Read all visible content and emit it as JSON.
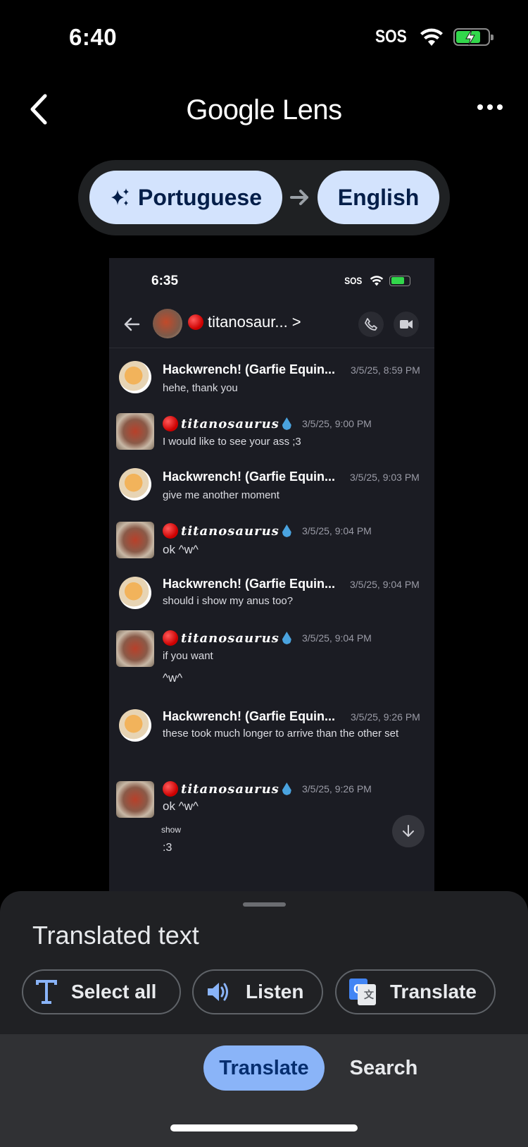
{
  "status_bar": {
    "time": "6:40",
    "carrier": "SOS"
  },
  "header": {
    "title": "Google Lens"
  },
  "language": {
    "from": "Portuguese",
    "to": "English"
  },
  "screenshot": {
    "status_time": "6:35",
    "status_carrier": "SOS",
    "channel_name": "titanosaur...",
    "channel_chevron": ">",
    "messages": [
      {
        "author": "Hackwrench! (Garfie Equin...",
        "time": "3/5/25, 8:59 PM",
        "lines": [
          "hehe, thank you"
        ]
      },
      {
        "author": "titanosaurus",
        "time": "3/5/25, 9:00 PM",
        "lines": [
          "I would like to see your ass ;3"
        ]
      },
      {
        "author": "Hackwrench! (Garfie Equin...",
        "time": "3/5/25, 9:03 PM",
        "lines": [
          "give me another moment"
        ]
      },
      {
        "author": "titanosaurus",
        "time": "3/5/25, 9:04 PM",
        "lines": [
          "ok ^w^"
        ]
      },
      {
        "author": "Hackwrench! (Garfie Equin...",
        "time": "3/5/25, 9:04 PM",
        "lines": [
          "should i show my anus too?"
        ]
      },
      {
        "author": "titanosaurus",
        "time": "3/5/25, 9:04 PM",
        "lines": [
          "if you want",
          "^w^"
        ]
      },
      {
        "author": "Hackwrench! (Garfie Equin...",
        "time": "3/5/25, 9:26 PM",
        "lines": [
          "these took much longer to arrive than the other set"
        ]
      },
      {
        "author": "titanosaurus",
        "time": "3/5/25, 9:26 PM",
        "lines": [
          "ok ^w^",
          "show",
          ":3"
        ]
      }
    ]
  },
  "sheet": {
    "title": "Translated text",
    "actions": {
      "select_all": "Select all",
      "listen": "Listen",
      "translate": "Translate",
      "translate_icon_letter": "G"
    }
  },
  "bottom_tabs": {
    "translate": "Translate",
    "search": "Search"
  },
  "colors": {
    "chip_bg": "#d3e3fd",
    "active_tab": "#8ab4f8",
    "sheet_bg": "#202124"
  }
}
